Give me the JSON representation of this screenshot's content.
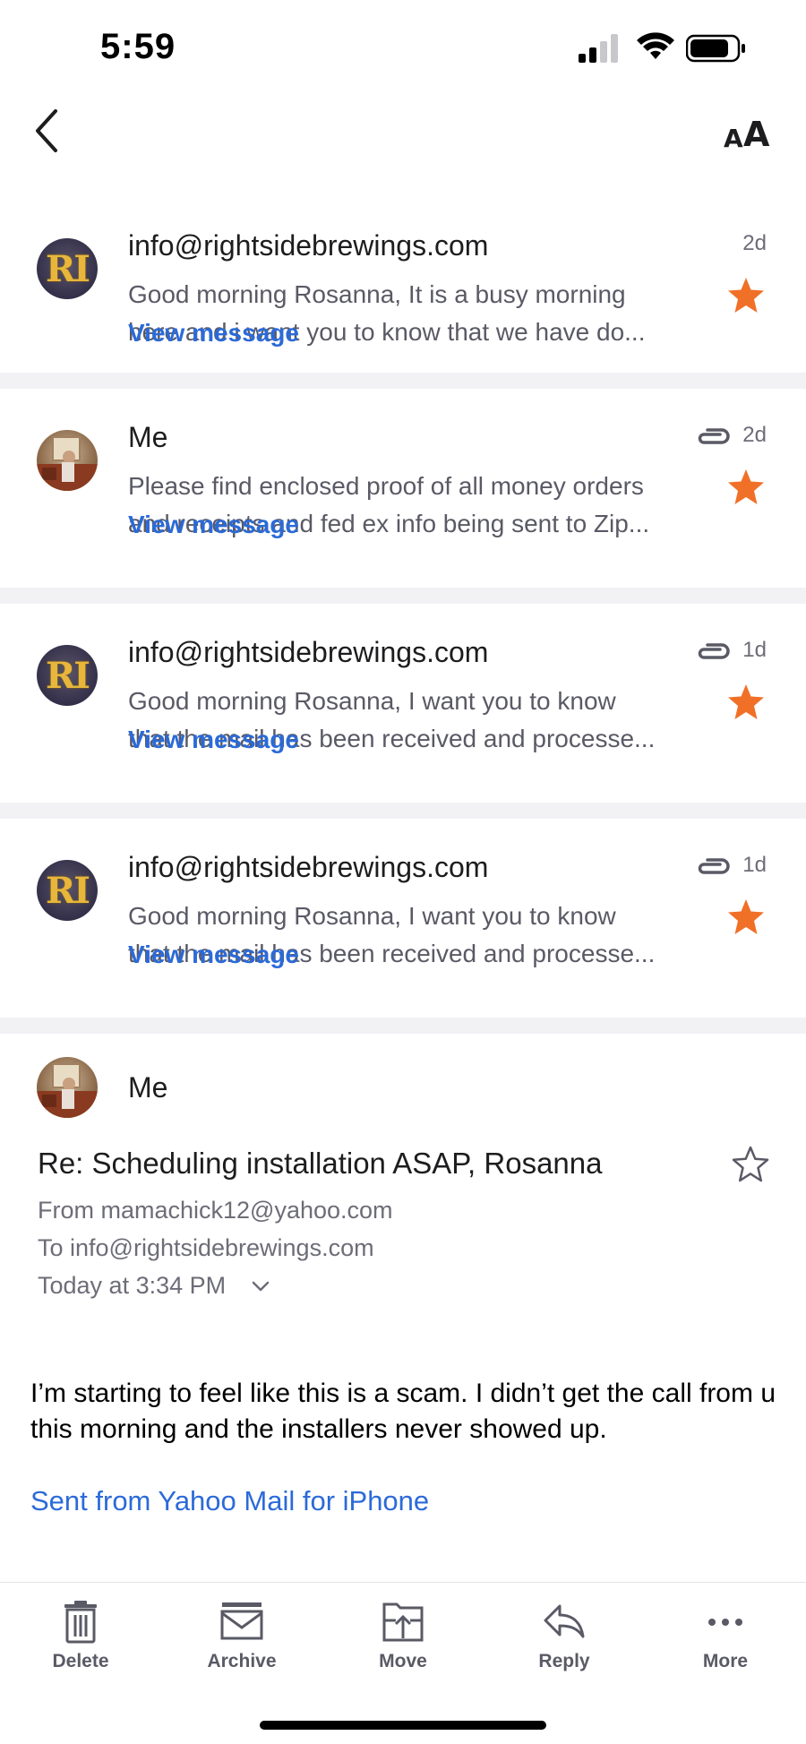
{
  "status_bar": {
    "time": "5:59"
  },
  "nav": {
    "text_size_small": "A",
    "text_size_large": "A"
  },
  "threads": [
    {
      "avatar_text": "RI",
      "sender": "info@rightsidebrewings.com",
      "snippet_line1": "Good morning Rosanna, It is a busy morning",
      "snippet_line2": "here and i want you to know that we have do...",
      "link": "View message",
      "age": "2d",
      "has_attachment": false,
      "starred": true
    },
    {
      "avatar_text": "",
      "sender": "Me",
      "snippet_line1": "Please find enclosed proof of all money orders",
      "snippet_line2": "and receipts and fed ex info being sent to Zip...",
      "link": "View message",
      "age": "2d",
      "has_attachment": true,
      "starred": true
    },
    {
      "avatar_text": "RI",
      "sender": "info@rightsidebrewings.com",
      "snippet_line1": "Good morning Rosanna, I want you to know",
      "snippet_line2": "that the mail has been received and processe...",
      "link": "View message",
      "age": "1d",
      "has_attachment": true,
      "starred": true
    },
    {
      "avatar_text": "RI",
      "sender": "info@rightsidebrewings.com",
      "snippet_line1": "Good morning Rosanna, I want you to know",
      "snippet_line2": "that the mail has been received and processe...",
      "link": "View message",
      "age": "1d",
      "has_attachment": true,
      "starred": true
    }
  ],
  "open_message": {
    "sender": "Me",
    "subject": "Re: Scheduling installation ASAP, Rosanna",
    "from": "From mamachick12@yahoo.com",
    "to": "To info@rightsidebrewings.com",
    "date": "Today at 3:34 PM",
    "body": "I’m starting to feel like this is a scam. I didn’t get the call from u this morning and the installers never showed up.",
    "signature": "Sent from Yahoo Mail for iPhone",
    "starred": false
  },
  "toolbar": {
    "delete": "Delete",
    "archive": "Archive",
    "move": "Move",
    "reply": "Reply",
    "more": "More"
  },
  "colors": {
    "link_blue": "#2b6ad8",
    "star_orange": "#f07028",
    "separator": "#f2f2f5"
  }
}
